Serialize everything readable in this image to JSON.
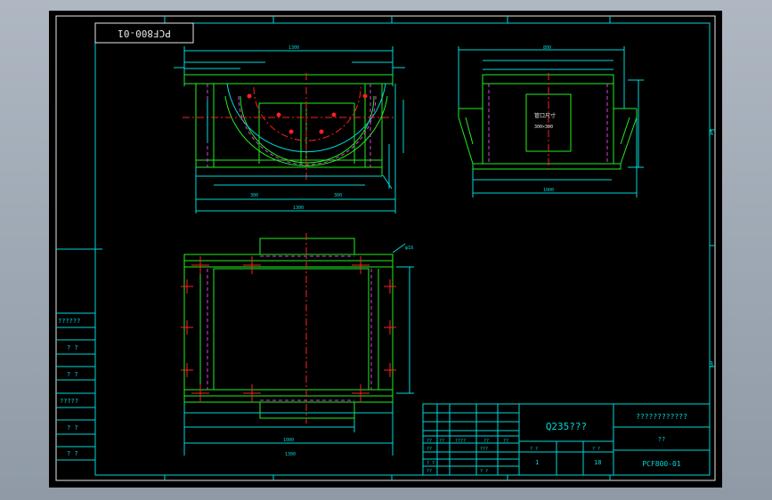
{
  "drawing": {
    "code_stamp": "PCF800-01",
    "material": "Q235???",
    "title_block_header": "????????????",
    "title_block_sub": "??",
    "drawing_number": "PCF800-01",
    "qty": "1",
    "scale": "18",
    "view_note": "????\n??\n?????",
    "zone_labels": [
      "A",
      "B"
    ]
  },
  "left_panel_labels": [
    "??????",
    "? ?",
    "? ?",
    "?????",
    "? ?",
    "? ?"
  ],
  "title_block_cells": {
    "row1": [
      "??",
      "??",
      "????",
      "??",
      "??"
    ],
    "row2": [
      "??",
      "???",
      "? ?",
      "? ?"
    ],
    "row3": [
      "? ?",
      "??",
      "? ?"
    ]
  }
}
